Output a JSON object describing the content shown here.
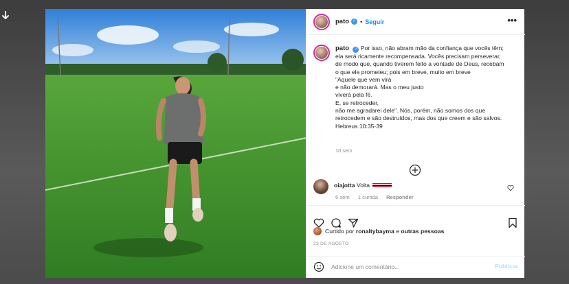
{
  "post": {
    "username": "pato",
    "follow_label": "Seguir",
    "dot": "•",
    "more_label": "•••",
    "caption_text": "Por isso, não abram mão da confiança que vocês têm;\nela será ricamente recompensada. Vocês precisam perseverar,\nde modo que, quando tiverem feito a vontade de Deus, recebam\no que ele prometeu; pois em breve, muito em breve\n\"Aquele que vem virá\ne não demorará. Mas o meu justo\nviverá pela fé.\nE, se retroceder,\nnão me agradarei dele\". Nós, porém, não somos dos que\nretrocedem e são destruídos, mas dos que creem e são salvos.\nHebreus 10:35-39",
    "caption_time": "10 sem",
    "verified_glyph": "✓"
  },
  "comment": {
    "username": "oiajotta",
    "text": "Volta",
    "time": "6 sem",
    "likes": "1 curtida",
    "reply_label": "Responder"
  },
  "likes": {
    "prefix": "Curtido por",
    "user": "ronaltybayma",
    "connector": "e",
    "others": "outras pessoas"
  },
  "date": "23 DE AGOSTO",
  "comment_box": {
    "placeholder": "Adicione um comentário...",
    "publish_label": "Publicar"
  },
  "colors": {
    "accent": "#0095f6",
    "publish_disabled": "#b2dffc",
    "secondary_text": "#8e8e8e"
  }
}
